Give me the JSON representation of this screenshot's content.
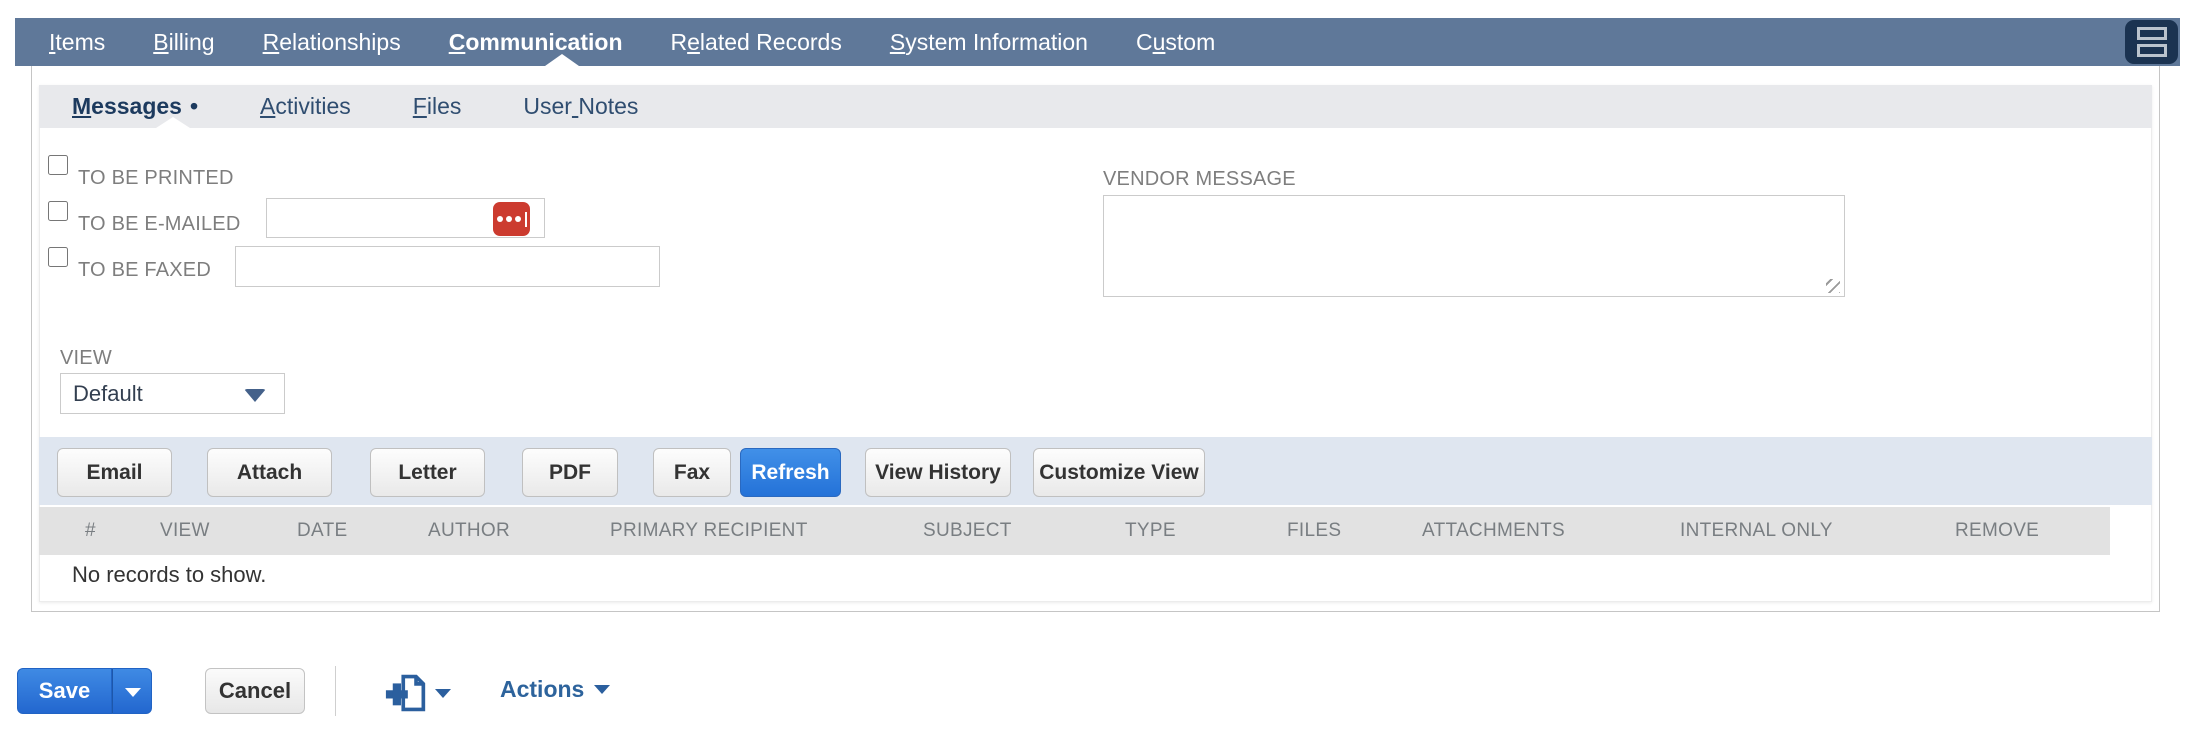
{
  "navbar": {
    "tabs": [
      {
        "pre": "",
        "key": "I",
        "post": "tems",
        "active": false
      },
      {
        "pre": "",
        "key": "B",
        "post": "illing",
        "active": false
      },
      {
        "pre": "",
        "key": "R",
        "post": "elationships",
        "active": false
      },
      {
        "pre": "",
        "key": "C",
        "post": "ommunication",
        "active": true
      },
      {
        "pre": "R",
        "key": "e",
        "post": "lated Records",
        "active": false
      },
      {
        "pre": "",
        "key": "S",
        "post": "ystem Information",
        "active": false
      },
      {
        "pre": "C",
        "key": "u",
        "post": "stom",
        "active": false
      }
    ]
  },
  "subtabs": {
    "items": [
      {
        "pre": "",
        "key": "M",
        "post": "essages",
        "marker": "•",
        "active": true
      },
      {
        "pre": "",
        "key": "A",
        "post": "ctivities",
        "marker": "",
        "active": false
      },
      {
        "pre": "",
        "key": "F",
        "post": "iles",
        "marker": "",
        "active": false
      },
      {
        "pre": "User",
        "key": " ",
        "post": "Notes",
        "marker": "",
        "active": false
      }
    ]
  },
  "form": {
    "to_be_printed_label": "TO BE PRINTED",
    "to_be_emailed_label": "TO BE E-MAILED",
    "to_be_faxed_label": "TO BE FAXED",
    "to_be_printed_checked": false,
    "to_be_emailed_checked": false,
    "to_be_faxed_checked": false,
    "email_value": "",
    "fax_value": "",
    "vendor_message_label": "VENDOR MESSAGE",
    "vendor_message_value": "",
    "view_label": "VIEW",
    "view_value": "Default"
  },
  "toolbar": {
    "email": "Email",
    "attach": "Attach",
    "letter": "Letter",
    "pdf": "PDF",
    "fax": "Fax",
    "refresh": "Refresh",
    "view_history": "View History",
    "customize_view": "Customize View"
  },
  "table": {
    "columns": [
      "#",
      "VIEW",
      "DATE",
      "AUTHOR",
      "PRIMARY RECIPIENT",
      "SUBJECT",
      "TYPE",
      "FILES",
      "ATTACHMENTS",
      "INTERNAL ONLY",
      "REMOVE"
    ],
    "empty_text": "No records to show."
  },
  "footer": {
    "save": "Save",
    "cancel": "Cancel",
    "actions": "Actions"
  },
  "icons": {
    "navbar_toggle": "form-layout-toggle-icon",
    "email_expander": "open-multiline-editor-icon",
    "view_dropdown": "chevron-down-icon",
    "save_dropdown": "chevron-down-icon",
    "add_record": "add-record-icon",
    "actions_dropdown": "chevron-down-icon"
  },
  "colors": {
    "navbar_bg": "#5f7899",
    "subtabbar_bg": "#e8e9ec",
    "toolstrip_bg": "#dfe6f0",
    "table_header_bg": "#e2e2e2",
    "primary_blue": "#2e7de0",
    "expander_red": "#cc3b2f",
    "link_blue": "#2d639c"
  }
}
